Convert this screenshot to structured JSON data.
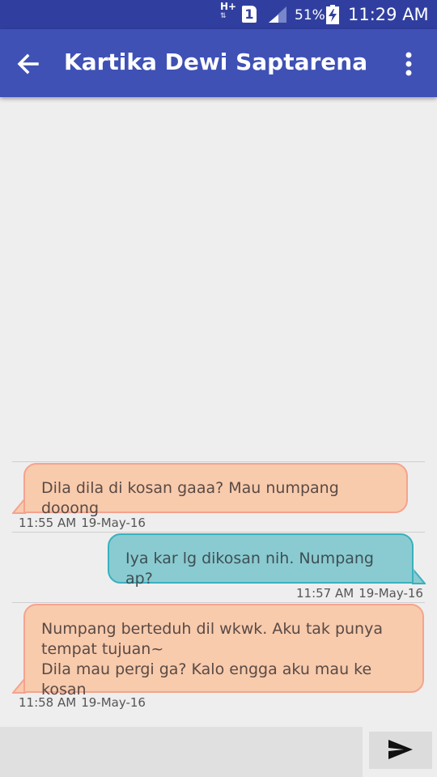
{
  "status_bar": {
    "network": "H+",
    "sim": "1",
    "battery_percent": "51%",
    "time": "11:29 AM"
  },
  "app_bar": {
    "title": "Kartika Dewi Saptarena",
    "back_icon": "arrow-left-icon",
    "menu_icon": "more-vertical-icon"
  },
  "messages": [
    {
      "direction": "incoming",
      "lines": [
        "Dila dila di kosan gaaa? Mau numpang dooong"
      ],
      "time": "11:55 AM",
      "date": "19-May-16"
    },
    {
      "direction": "outgoing",
      "lines": [
        "Iya kar lg dikosan nih. Numpang ap?"
      ],
      "time": "11:57 AM",
      "date": "19-May-16"
    },
    {
      "direction": "incoming",
      "lines": [
        "Numpang berteduh dil wkwk. Aku tak punya",
        "tempat tujuan~",
        "Dila mau pergi ga? Kalo engga aku mau ke kosan"
      ],
      "time": "11:58 AM",
      "date": "19-May-16"
    }
  ],
  "composer": {
    "input_value": "",
    "send_icon": "send-icon"
  },
  "colors": {
    "status_bar": "#303f9f",
    "app_bar": "#3f51b5",
    "incoming_bubble": "#f8cbad",
    "outgoing_bubble": "#8acbd1",
    "background": "#eeeeee"
  }
}
